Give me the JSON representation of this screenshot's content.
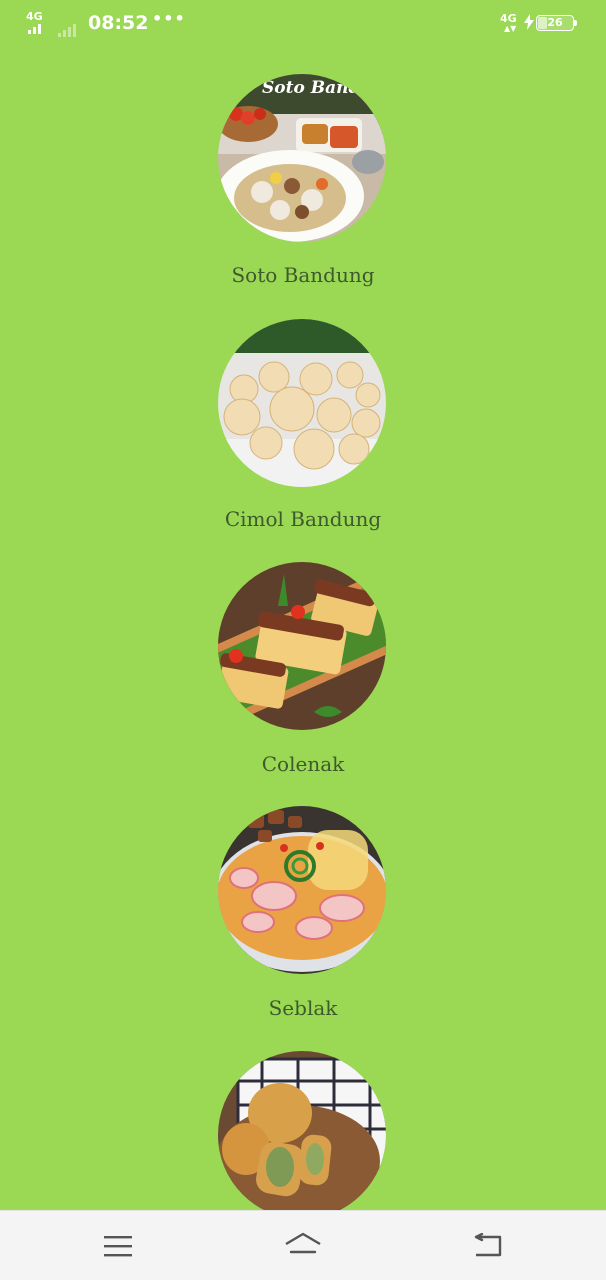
{
  "status_bar": {
    "network_left": "4G",
    "time": "08:52",
    "more": "•••",
    "network_right": "4G",
    "battery": "26"
  },
  "foods": [
    {
      "name": "Soto Bandung",
      "image_caption": "Soto Banduu"
    },
    {
      "name": "Cimol Bandung"
    },
    {
      "name": "Colenak"
    },
    {
      "name": "Seblak"
    },
    {
      "name": ""
    }
  ],
  "nav": {
    "menu_icon": "menu-icon",
    "home_icon": "home-icon",
    "back_icon": "back-icon"
  }
}
